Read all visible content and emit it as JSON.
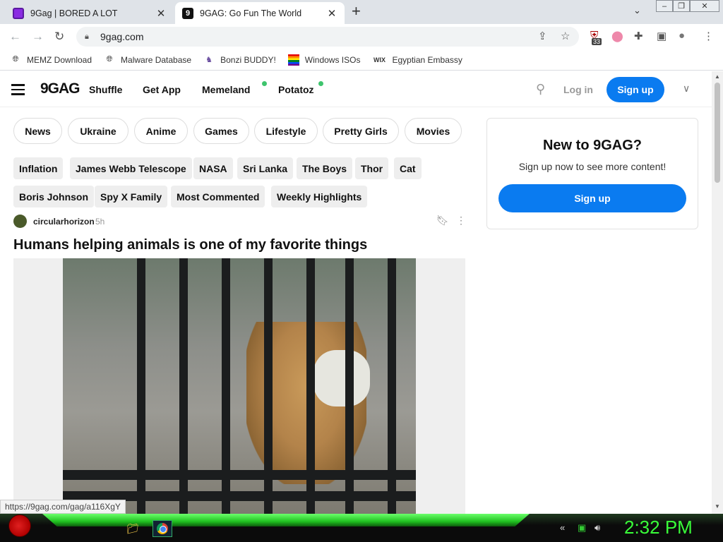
{
  "browser": {
    "tabs": [
      {
        "title": "9Gag | BORED A LOT",
        "active": false
      },
      {
        "title": "9GAG: Go Fun The World",
        "active": true,
        "favicon_text": "9"
      }
    ],
    "new_tab": "+",
    "tab_menu": "⌄",
    "window_controls": {
      "minimize": "‒",
      "restore": "❐",
      "close": "✕"
    },
    "url": "9gag.com",
    "extension_badge": "33",
    "bookmarks": [
      {
        "label": "MEMZ Download",
        "icon": "globe-icon"
      },
      {
        "label": "Malware Database",
        "icon": "globe-icon"
      },
      {
        "label": "Bonzi BUDDY!",
        "icon": "bonzi-icon"
      },
      {
        "label": "Windows ISOs",
        "icon": "rainbow-icon"
      },
      {
        "label": "Egyptian Embassy",
        "icon": "wix-icon",
        "icon_text": "WIX"
      }
    ],
    "status_url": "https://9gag.com/gag/a116XgY"
  },
  "site": {
    "logo": "9GAG",
    "nav": [
      {
        "label": " Shuffle",
        "dot": false
      },
      {
        "label": " Get App",
        "dot": false
      },
      {
        "label": " Memeland",
        "dot": true
      },
      {
        "label": " Potatoz",
        "dot": true
      }
    ],
    "login": "Log in",
    "signup": "Sign up",
    "categories": [
      "News",
      "Ukraine",
      "Anime",
      "Games",
      "Lifestyle",
      "Pretty Girls",
      "Movies"
    ],
    "tags_row1": [
      "Inflation",
      "James Webb Telescope",
      "NASA",
      "Sri Lanka",
      "The Boys",
      "Thor",
      "Cat"
    ],
    "tags_row2": [
      "Boris Johnson",
      "Spy X Family",
      "Most Commented",
      "Weekly Highlights"
    ],
    "post": {
      "author": "circularhorizon",
      "age": "5h",
      "title": "Humans helping animals is one of my favorite things"
    },
    "sidebar": {
      "heading": "New to 9GAG?",
      "text": "Sign up now to see more content!",
      "button": "Sign up"
    }
  },
  "taskbar": {
    "clock": "2:32 PM"
  },
  "colors": {
    "accent": "#0a7bf0",
    "clock": "#39ff39",
    "new_dot": "#3ec46d"
  }
}
